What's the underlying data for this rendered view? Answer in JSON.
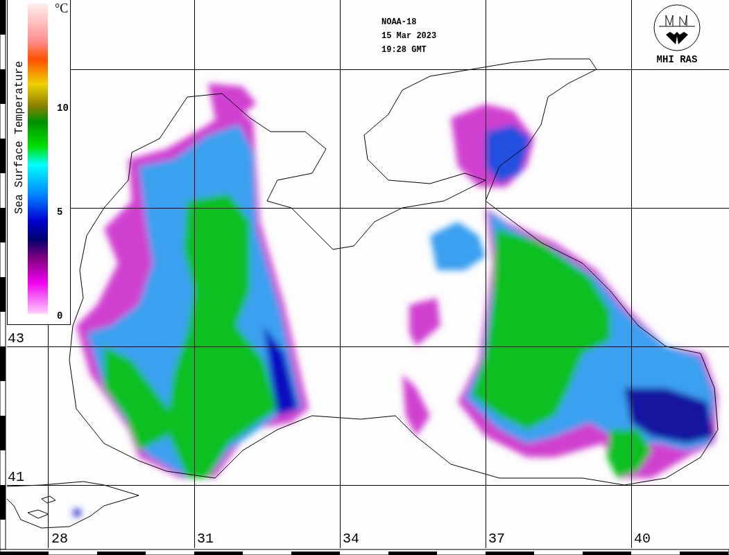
{
  "header": {
    "lines": [
      "NOAA-18",
      "15 Mar 2023",
      "19:28 GMT"
    ]
  },
  "logo": {
    "caption": "MHI RAS"
  },
  "legend": {
    "title": "Sea Surface Temperature",
    "unit": "°C",
    "ticks": [
      "10",
      "5",
      "0"
    ]
  },
  "latitude_labels": [
    "43",
    "41"
  ],
  "longitude_labels": [
    "28",
    "31",
    "34",
    "37",
    "40"
  ]
}
